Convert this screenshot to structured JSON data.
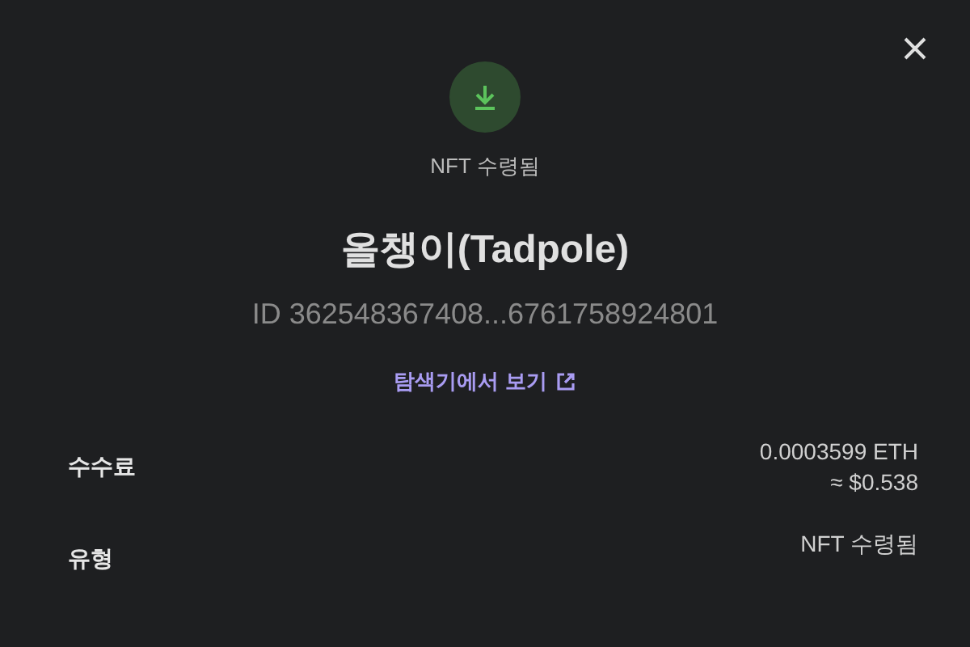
{
  "status": {
    "label": "NFT 수령됨"
  },
  "title": "올챙이(Tadpole)",
  "token_id": "ID 362548367408...6761758924801",
  "explorer_link": "탐색기에서 보기",
  "details": [
    {
      "label": "수수료",
      "value": "0.0003599 ETH",
      "secondary": "≈ $0.538"
    },
    {
      "label": "유형",
      "value": "NFT 수령됨"
    }
  ]
}
